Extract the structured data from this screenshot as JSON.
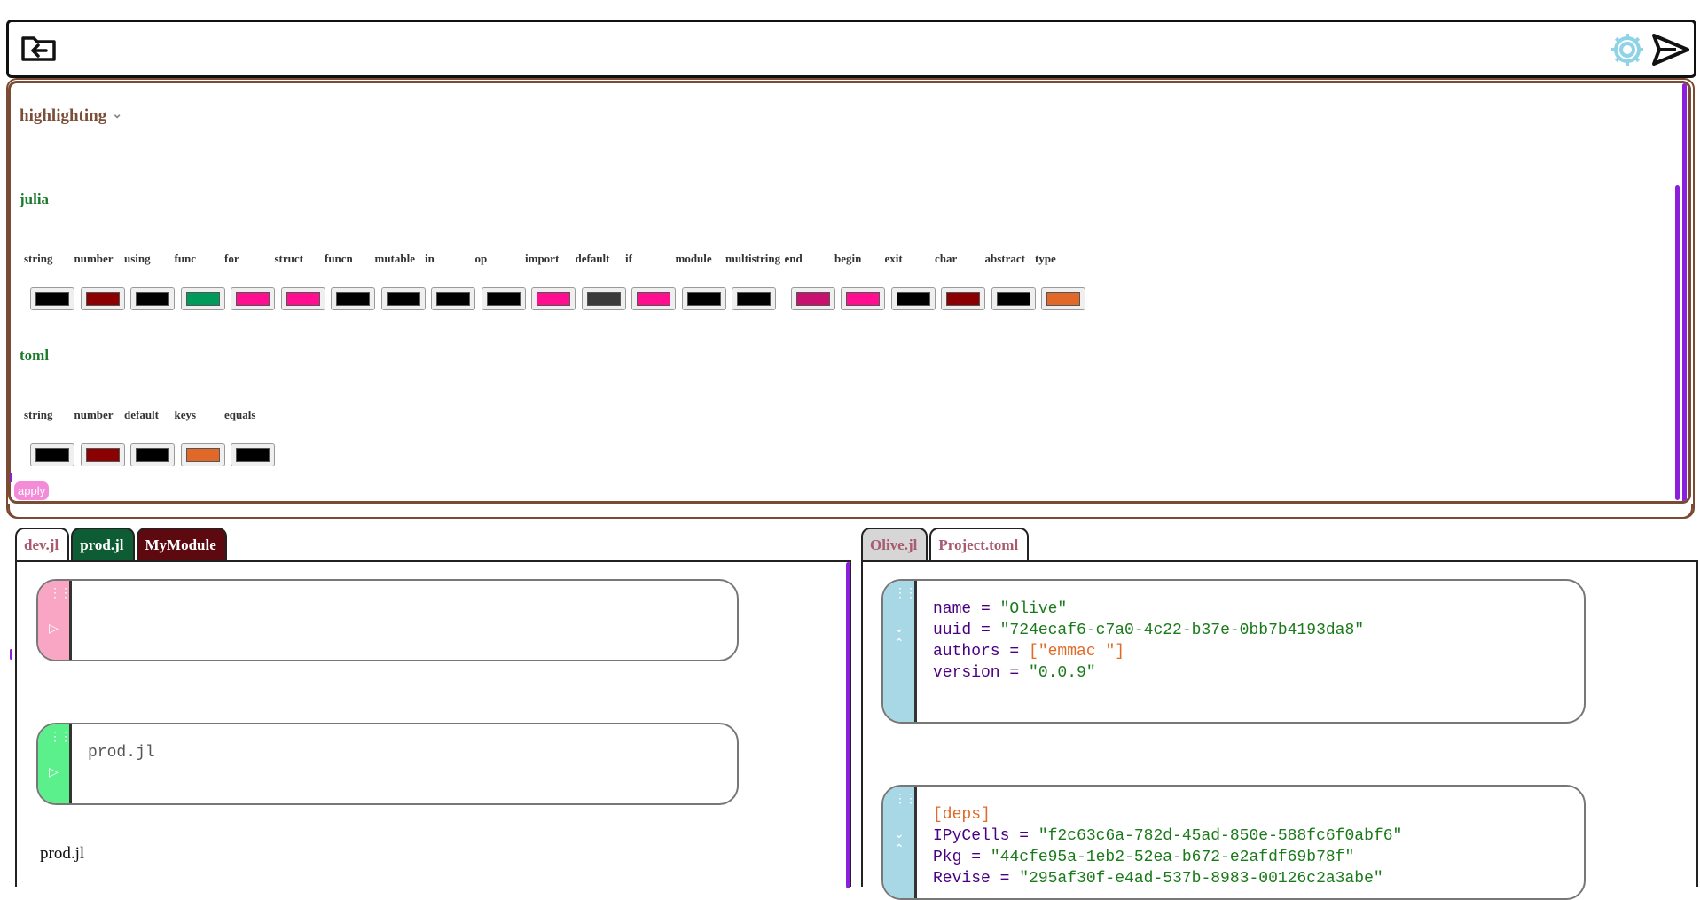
{
  "topbar": {
    "left_icon": "folder-back-icon",
    "right_icons": [
      "gear-icon",
      "send-icon"
    ]
  },
  "settings": {
    "section_title": "highlighting",
    "apply_label": "apply",
    "languages": [
      {
        "name": "julia",
        "fields": [
          {
            "label": "string",
            "color": "#000000"
          },
          {
            "label": "number",
            "color": "#8b0000"
          },
          {
            "label": "using",
            "color": "#000000"
          },
          {
            "label": "func",
            "color": "#009b5a"
          },
          {
            "label": "for",
            "color": "#ff0f8f"
          },
          {
            "label": "struct",
            "color": "#ff0f8f"
          },
          {
            "label": "funcn",
            "color": "#000000"
          },
          {
            "label": "mutable",
            "color": "#000000"
          },
          {
            "label": "in",
            "color": "#000000"
          },
          {
            "label": "op",
            "color": "#000000"
          },
          {
            "label": "import",
            "color": "#ff0f8f"
          },
          {
            "label": "default",
            "color": "#3a3a3a"
          },
          {
            "label": "if",
            "color": "#ff0f8f"
          },
          {
            "label": "module",
            "color": "#000000"
          },
          {
            "label": "multistring",
            "color": "#000000"
          },
          {
            "label": "end",
            "color": "#c8106e"
          },
          {
            "label": "begin",
            "color": "#ff0f8f"
          },
          {
            "label": "exit",
            "color": "#000000"
          },
          {
            "label": "char",
            "color": "#8b0000"
          },
          {
            "label": "abstract",
            "color": "#000000"
          },
          {
            "label": "type",
            "color": "#e0692a"
          }
        ]
      },
      {
        "name": "toml",
        "fields": [
          {
            "label": "string",
            "color": "#000000"
          },
          {
            "label": "number",
            "color": "#8b0000"
          },
          {
            "label": "default",
            "color": "#000000"
          },
          {
            "label": "keys",
            "color": "#e0692a"
          },
          {
            "label": "equals",
            "color": "#000000"
          }
        ]
      }
    ]
  },
  "left_pane": {
    "tabs": [
      {
        "label": "dev.jl",
        "style": "plain"
      },
      {
        "label": "prod.jl",
        "style": "green"
      },
      {
        "label": "MyModule",
        "style": "maroon"
      }
    ],
    "cells": [
      {
        "side_color": "#f9a6c4",
        "icon": "run-icon",
        "text": ""
      },
      {
        "side_color": "#5cf08d",
        "icon": "run-icon",
        "text": "prod.jl"
      }
    ],
    "plain_text": "prod.jl"
  },
  "right_pane": {
    "tabs": [
      {
        "label": "Olive.jl",
        "style": "grey"
      },
      {
        "label": "Project.toml",
        "style": "plain"
      }
    ],
    "cells": [
      {
        "side_color": "#a8d8e6",
        "icon": "collapse-icon",
        "lines": [
          {
            "key": "name",
            "value": "\"Olive\""
          },
          {
            "key": "uuid",
            "value": "\"724ecaf6-c7a0-4c22-b37e-0bb7b4193da8\""
          },
          {
            "key": "authors",
            "value": "[\"emmac \"]",
            "array": true
          },
          {
            "key": "version",
            "value": "\"0.0.9\""
          }
        ]
      },
      {
        "side_color": "#a8d8e6",
        "icon": "collapse-icon",
        "header": "[deps]",
        "lines": [
          {
            "key": "IPyCells",
            "value": "\"f2c63c6a-782d-45ad-850e-588fc6f0abf6\""
          },
          {
            "key": "Pkg",
            "value": "\"44cfe95a-1eb2-52ea-b672-e2afdf69b78f\""
          },
          {
            "key": "Revise",
            "value": "\"295af30f-e4ad-537b-8983-00126c2a3abe\""
          }
        ]
      }
    ]
  }
}
